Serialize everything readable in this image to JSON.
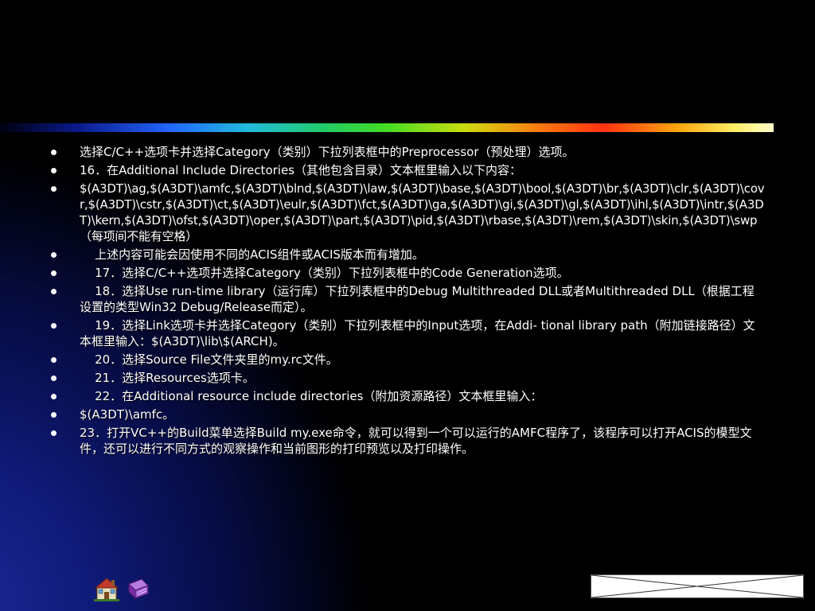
{
  "slide": {
    "bullets": [
      "选择C/C++选项卡并选择Category（类别）下拉列表框中的Preprocessor（预处理）选项。",
      "16．在Additional Include Directories（其他包含目录）文本框里输入以下内容：",
      "$(A3DT)\\ag,$(A3DT)\\amfc,$(A3DT)\\blnd,$(A3DT)\\law,$(A3DT)\\base,$(A3DT)\\bool,$(A3DT)\\br,$(A3DT)\\clr,$(A3DT)\\covr,$(A3DT)\\cstr,$(A3DT)\\ct,$(A3DT)\\eulr,$(A3DT)\\fct,$(A3DT)\\ga,$(A3DT)\\gi,$(A3DT)\\gl,$(A3DT)\\ihl,$(A3DT)\\intr,$(A3DT)\\kern,$(A3DT)\\ofst,$(A3DT)\\oper,$(A3DT)\\part,$(A3DT)\\pid,$(A3DT)\\rbase,$(A3DT)\\rem,$(A3DT)\\skin,$(A3DT)\\swp（每项间不能有空格）",
      "    上述内容可能会因使用不同的ACIS组件或ACIS版本而有增加。",
      "    17．选择C/C++选项并选择Category（类别）下拉列表框中的Code Generation选项。",
      "    18．选择Use run-time library（运行库）下拉列表框中的Debug Multithreaded DLL或者Multithreaded DLL（根据工程设置的类型Win32 Debug/Release而定）。",
      "    19．选择Link选项卡并选择Category（类别）下拉列表框中的Input选项，在Addi- tional library path（附加链接路径）文本框里输入：$(A3DT)\\lib\\$(ARCH)。",
      "    20．选择Source File文件夹里的my.rc文件。",
      "    21．选择Resources选项卡。",
      "    22．在Additional resource include directories（附加资源路径）文本框里输入：",
      "$(A3DT)\\amfc。",
      "23．打开VC++的Build菜单选择Build my.exe命令，就可以得到一个可以运行的AMFC程序了，该程序可以打开ACIS的模型文件，还可以进行不同方式的观察操作和当前图形的打印预览以及打印操作。"
    ]
  },
  "nav": {
    "home_icon": "home-icon",
    "book_icon": "book-icon",
    "box_icon": "crossed-box-icon"
  },
  "colors": {
    "background": "#000000",
    "text": "#ffffff",
    "glow": "#1d2a9a"
  }
}
